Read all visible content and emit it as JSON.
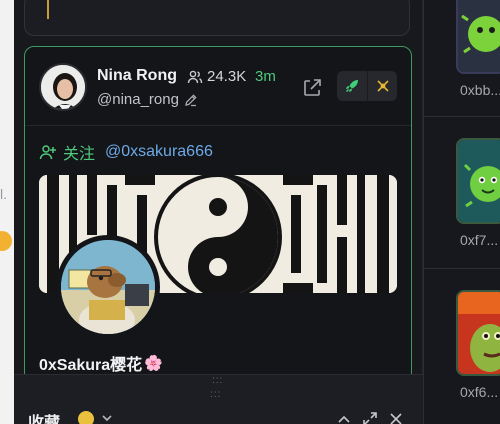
{
  "profile": {
    "name": "Nina Rong",
    "followers": "24.3K",
    "age": "3m",
    "handle": "@nina_rong"
  },
  "follow_action": {
    "verb": "关注",
    "target": "@0xsakura666"
  },
  "followed_profile": {
    "name": "0xSakura樱花",
    "emoji": "🌸"
  },
  "drawer": {
    "title": "收藏",
    "grip": ":::"
  },
  "side_list": {
    "items": [
      {
        "address": "0xbb..."
      },
      {
        "address": "0xf7..."
      },
      {
        "address": "0xf6..."
      }
    ]
  },
  "page_sliver": {
    "text": "l."
  },
  "colors": {
    "accent_green": "#4fc97c",
    "link_blue": "#6ea9e6",
    "card_border": "#3f9a62",
    "background": "#16181d"
  },
  "icons": [
    "user-group-icon",
    "edit-icon",
    "external-link-icon",
    "rocket-icon",
    "sword-icon",
    "user-plus-icon",
    "chevron-down-icon",
    "chevron-up-icon",
    "expand-icon",
    "close-icon"
  ]
}
